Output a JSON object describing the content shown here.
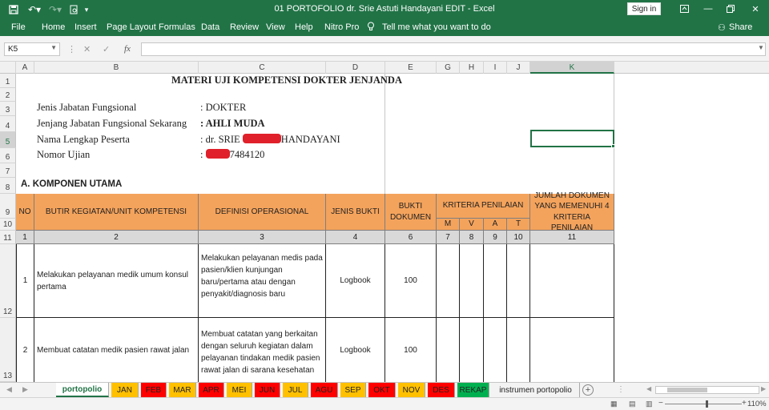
{
  "window": {
    "title": "01 PORTOFOLIO dr. Srie Astuti Handayani EDIT  -  Excel",
    "sign_in": "Sign in",
    "colors": {
      "brand": "#217346",
      "header_fill": "#f4a35c",
      "index_fill": "#d9d9d9",
      "redaction": "#e0202a"
    }
  },
  "ribbon": {
    "tabs": [
      "File",
      "Home",
      "Insert",
      "Page Layout",
      "Formulas",
      "Data",
      "Review",
      "View",
      "Help",
      "Nitro Pro"
    ],
    "tell_me": "Tell me what you want to do",
    "share": "Share"
  },
  "formula_bar": {
    "name_box": "K5",
    "cancel": "✕",
    "enter": "✓",
    "fx": "fx",
    "value": ""
  },
  "columns": [
    "A",
    "B",
    "C",
    "D",
    "E",
    "G",
    "H",
    "I",
    "J",
    "K"
  ],
  "rows": [
    "1",
    "2",
    "3",
    "4",
    "5",
    "6",
    "7",
    "8",
    "9",
    "10",
    "11",
    "12",
    "13"
  ],
  "sheet": {
    "title": "MATERI UJI KOMPETENSI DOKTER JENJANDA",
    "info": [
      {
        "label": "Jenis  Jabatan Fungsional",
        "value": ":  DOKTER",
        "bold": false
      },
      {
        "label": "Jenjang Jabatan Fungsional Sekarang",
        "value": ": AHLI MUDA",
        "bold": true
      },
      {
        "label": "Nama Lengkap Peserta",
        "value_prefix": ": dr. SRIE ",
        "value_suffix": "HANDAYANI"
      },
      {
        "label": "Nomor Ujian",
        "value_prefix": ": ",
        "value_suffix": "7484120"
      }
    ],
    "section": "A.   KOMPONEN UTAMA",
    "headers": {
      "no": "NO",
      "butir": "BUTIR KEGIATAN/UNIT KOMPETENSI",
      "definisi": "DEFINISI OPERASIONAL",
      "jenis": "JENIS BUKTI",
      "bukti": "BUKTI DOKUMEN",
      "kriteria": "KRITERIA PENILAIAN",
      "kriteria_sub": [
        "M",
        "V",
        "A",
        "T"
      ],
      "jumlah": "JUMLAH DOKUMEN YANG MEMENUHI 4 KRITERIA PENILAIAN"
    },
    "index_row": [
      "1",
      "2",
      "3",
      "4",
      "6",
      "7",
      "8",
      "9",
      "10",
      "11"
    ],
    "rows": [
      {
        "no": "1",
        "butir": "Melakukan pelayanan medik umum konsul pertama",
        "definisi": "Melakukan pelayanan medis pada pasien/klien kunjungan baru/pertama atau dengan penyakit/diagnosis baru",
        "jenis": "Logbook",
        "bukti": "100"
      },
      {
        "no": "2",
        "butir": "Membuat catatan medik pasien rawat jalan",
        "definisi": "Membuat catatan yang berkaitan dengan seluruh kegiatan dalam pelayanan tindakan medik pasien rawat jalan di sarana kesehatan",
        "jenis": "Logbook",
        "bukti": "100"
      }
    ]
  },
  "sheet_tabs": [
    {
      "label": "portopolio",
      "color": "#ffffff",
      "active": true
    },
    {
      "label": "JAN",
      "color": "#ffc000"
    },
    {
      "label": "FEB",
      "color": "#ff0000"
    },
    {
      "label": "MAR",
      "color": "#ffc000"
    },
    {
      "label": "APR",
      "color": "#ff0000"
    },
    {
      "label": "MEI",
      "color": "#ffc000"
    },
    {
      "label": "JUN",
      "color": "#ff0000"
    },
    {
      "label": "JUL",
      "color": "#ffc000"
    },
    {
      "label": "AGU",
      "color": "#ff0000"
    },
    {
      "label": "SEP",
      "color": "#ffc000"
    },
    {
      "label": "OKT",
      "color": "#ff0000"
    },
    {
      "label": "NOV",
      "color": "#ffc000"
    },
    {
      "label": "DES",
      "color": "#ff0000"
    },
    {
      "label": "REKAP",
      "color": "#00b050"
    },
    {
      "label": "instrumen portopolio",
      "color": "#f3f3f3"
    }
  ],
  "status": {
    "zoom": "110%"
  }
}
